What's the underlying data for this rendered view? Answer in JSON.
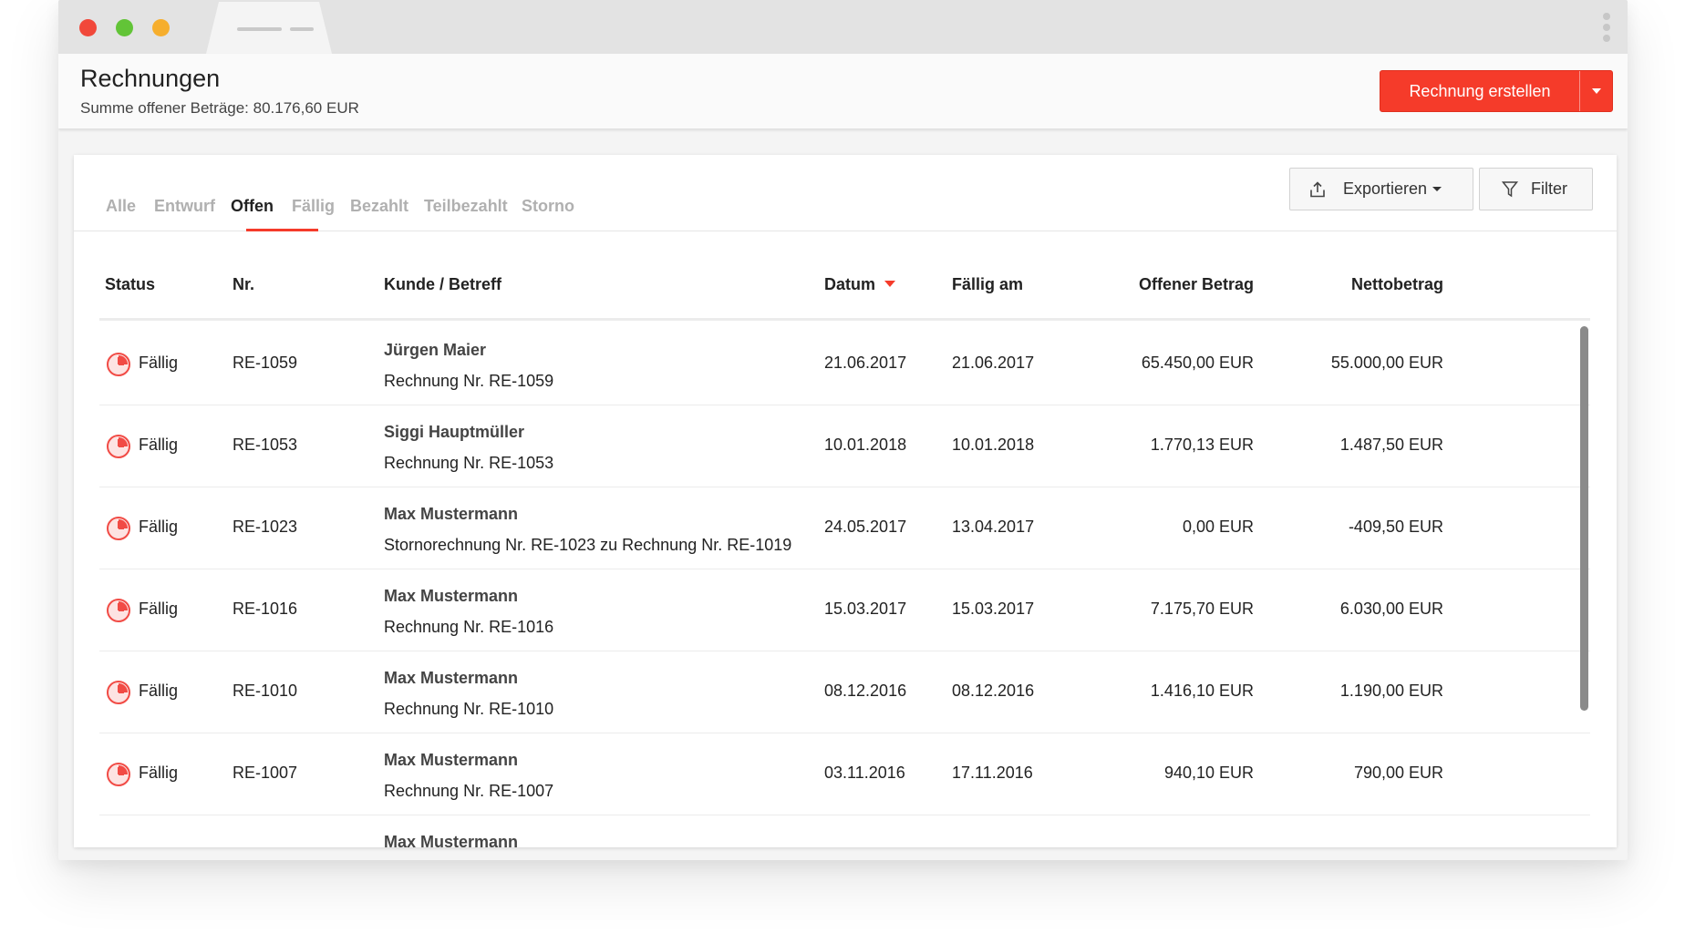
{
  "window": {
    "controls": [
      "close",
      "minimize",
      "zoom"
    ]
  },
  "header": {
    "title": "Rechnungen",
    "subtitle": "Summe offener Beträge: 80.176,60 EUR",
    "create_label": "Rechnung erstellen"
  },
  "tabs": [
    {
      "label": "Alle",
      "active": false
    },
    {
      "label": "Entwurf",
      "active": false
    },
    {
      "label": "Offen",
      "active": true
    },
    {
      "label": "Fällig",
      "active": false
    },
    {
      "label": "Bezahlt",
      "active": false
    },
    {
      "label": "Teilbezahlt",
      "active": false
    },
    {
      "label": "Storno",
      "active": false
    }
  ],
  "toolbar": {
    "export_label": "Exportieren",
    "filter_label": "Filter"
  },
  "table": {
    "columns": {
      "status": "Status",
      "nr": "Nr.",
      "kunde": "Kunde / Betreff",
      "datum": "Datum",
      "faellig": "Fällig am",
      "offen": "Offener Betrag",
      "netto": "Nettobetrag"
    },
    "sort": {
      "column": "datum",
      "direction": "desc"
    },
    "rows": [
      {
        "status": "Fällig",
        "nr": "RE-1059",
        "name": "Jürgen Maier",
        "betreff": "Rechnung Nr. RE-1059",
        "datum": "21.06.2017",
        "faellig": "21.06.2017",
        "offen": "65.450,00 EUR",
        "netto": "55.000,00 EUR"
      },
      {
        "status": "Fällig",
        "nr": "RE-1053",
        "name": "Siggi Hauptmüller",
        "betreff": "Rechnung Nr. RE-1053",
        "datum": "10.01.2018",
        "faellig": "10.01.2018",
        "offen": "1.770,13 EUR",
        "netto": "1.487,50 EUR"
      },
      {
        "status": "Fällig",
        "nr": "RE-1023",
        "name": "Max Mustermann",
        "betreff": "Stornorechnung Nr. RE-1023 zu Rechnung Nr. RE-1019",
        "datum": "24.05.2017",
        "faellig": "13.04.2017",
        "offen": "0,00 EUR",
        "netto": "-409,50 EUR"
      },
      {
        "status": "Fällig",
        "nr": "RE-1016",
        "name": "Max Mustermann",
        "betreff": "Rechnung Nr. RE-1016",
        "datum": "15.03.2017",
        "faellig": "15.03.2017",
        "offen": "7.175,70 EUR",
        "netto": "6.030,00 EUR"
      },
      {
        "status": "Fällig",
        "nr": "RE-1010",
        "name": "Max Mustermann",
        "betreff": "Rechnung Nr. RE-1010",
        "datum": "08.12.2016",
        "faellig": "08.12.2016",
        "offen": "1.416,10 EUR",
        "netto": "1.190,00 EUR"
      },
      {
        "status": "Fällig",
        "nr": "RE-1007",
        "name": "Max Mustermann",
        "betreff": "Rechnung Nr. RE-1007",
        "datum": "03.11.2016",
        "faellig": "17.11.2016",
        "offen": "940,10 EUR",
        "netto": "790,00 EUR"
      },
      {
        "status": "",
        "nr": "",
        "name": "Max Mustermann",
        "betreff": "",
        "datum": "",
        "faellig": "",
        "offen": "",
        "netto": ""
      }
    ]
  },
  "colors": {
    "accent": "#f53b2a",
    "status_due": "#f14b45",
    "tab_inactive": "#b0b0b0",
    "text_dark": "#222222"
  },
  "icons": {
    "export": "upload-icon",
    "filter": "funnel-icon",
    "status_due": "clock-icon"
  }
}
